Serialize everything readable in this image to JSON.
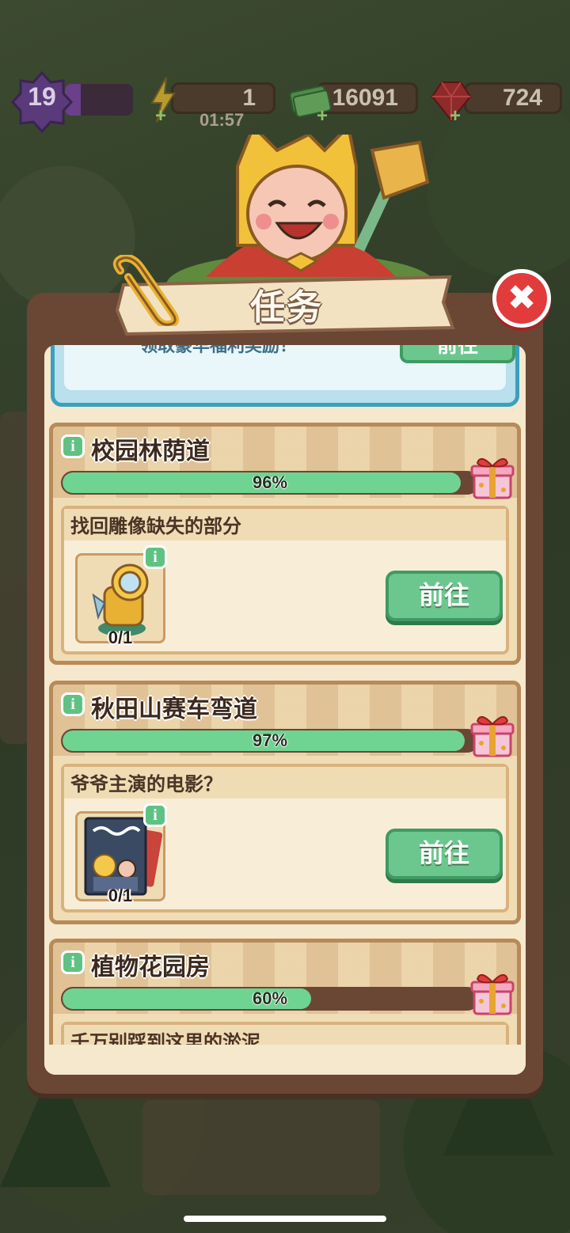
{
  "hud": {
    "level": "19",
    "energy": "1",
    "energy_timer": "01:57",
    "cash": "16091",
    "gems": "724"
  },
  "dialog": {
    "title": "任务",
    "close_icon": "✖"
  },
  "promo": {
    "text": "领取豪华福利奖励！",
    "button": "前往"
  },
  "quests": [
    {
      "title": "校园林荫道",
      "progress_label": "96%",
      "progress": 0.96,
      "task": "找回雕像缺失的部分",
      "item_icon": "golden-statue-part-icon",
      "count": "0/1",
      "button": "前往"
    },
    {
      "title": "秋田山赛车弯道",
      "progress_label": "97%",
      "progress": 0.97,
      "task": "爷爷主演的电影？",
      "item_icon": "movie-poster-icon",
      "count": "0/1",
      "button": "前往"
    },
    {
      "title": "植物花园房",
      "progress_label": "60%",
      "progress": 0.6,
      "task": "千万别踩到这里的淤泥"
    }
  ],
  "info_icon": "i",
  "colors": {
    "progress_fill": "#6fd491",
    "button_green": "#6cc78e",
    "close_red": "#e23b3b",
    "panel_brown": "#6a4634"
  }
}
